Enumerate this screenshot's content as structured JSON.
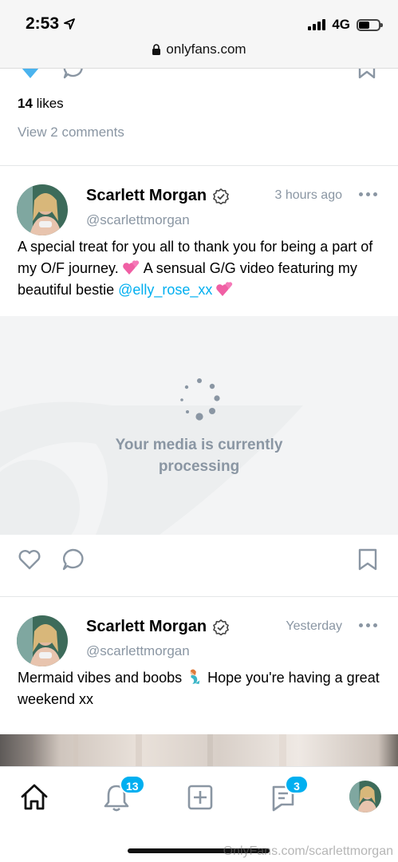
{
  "status_bar": {
    "time": "2:53",
    "network": "4G",
    "url": "onlyfans.com"
  },
  "previous_post": {
    "likes_count": "14",
    "likes_label": "likes",
    "view_comments": "View 2 comments"
  },
  "posts": [
    {
      "author": "Scarlett Morgan",
      "handle": "@scarlettmorgan",
      "time": "3 hours ago",
      "text_before": "A special treat for you all to thank you for being a part of my O/F journey. ",
      "text_middle": " A sensual G/G video featuring my beautiful bestie ",
      "mention": "@elly_rose_xx",
      "media_status": "Your media is currently processing"
    },
    {
      "author": "Scarlett Morgan",
      "handle": "@scarlettmorgan",
      "time": "Yesterday",
      "text_before": "Mermaid vibes and boobs ",
      "text_after": " Hope you're having a great weekend xx"
    }
  ],
  "tab_bar": {
    "notifications_badge": "13",
    "messages_badge": "3"
  },
  "watermark": "OnlyFans.com/scarlettmorgan",
  "colors": {
    "accent": "#00aff0",
    "muted": "#8a96a3"
  },
  "icons": [
    "location-arrow-icon",
    "lock-icon",
    "heart-icon",
    "comment-icon",
    "bookmark-icon",
    "verified-icon",
    "more-icon",
    "home-icon",
    "bell-icon",
    "plus-square-icon",
    "messages-icon"
  ]
}
